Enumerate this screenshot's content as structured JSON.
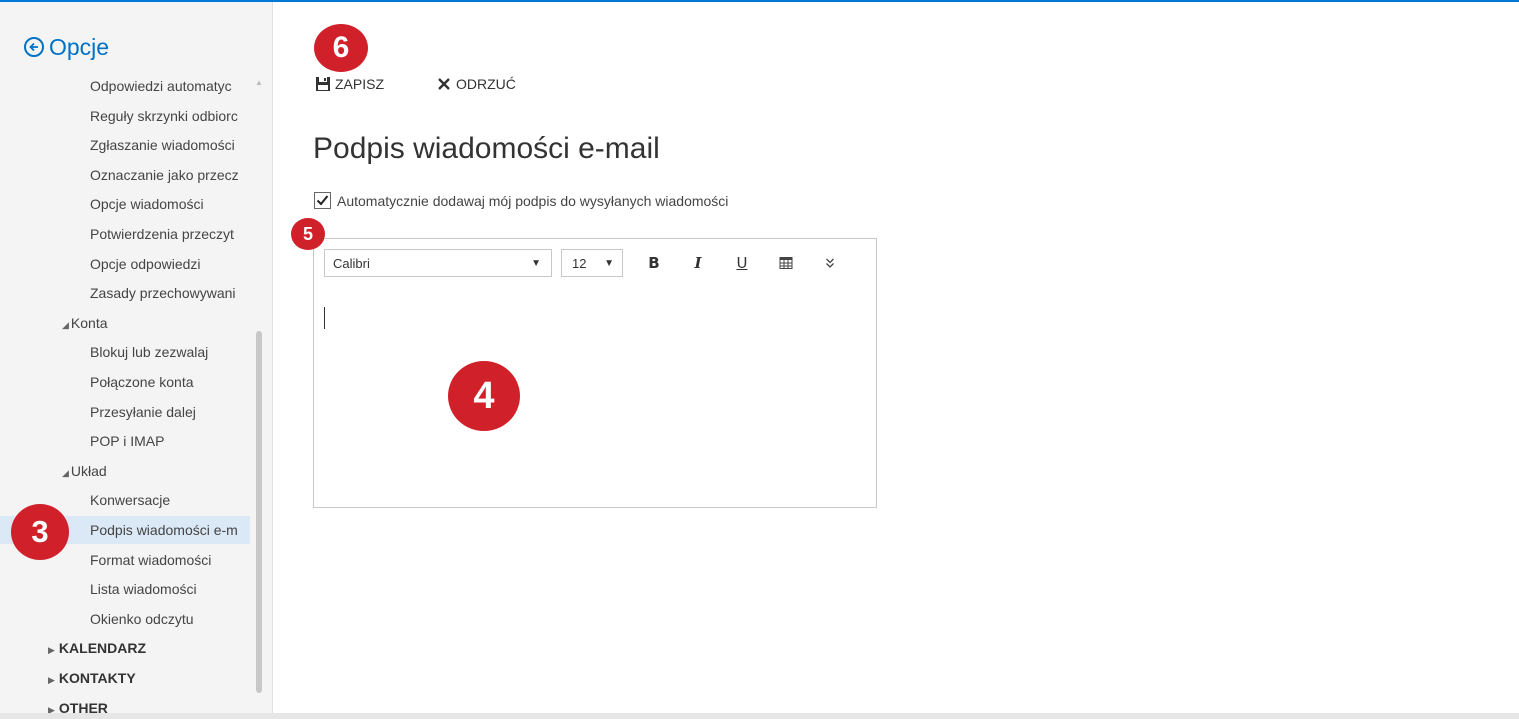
{
  "sidebar": {
    "back_label": "Opcje",
    "items": [
      {
        "label": "Odpowiedzi automatyc",
        "level": "sub"
      },
      {
        "label": "Reguły skrzynki odbiorc",
        "level": "sub"
      },
      {
        "label": "Zgłaszanie wiadomości",
        "level": "sub"
      },
      {
        "label": "Oznaczanie jako przecz",
        "level": "sub"
      },
      {
        "label": "Opcje wiadomości",
        "level": "sub"
      },
      {
        "label": "Potwierdzenia przeczyt",
        "level": "sub"
      },
      {
        "label": "Opcje odpowiedzi",
        "level": "sub"
      },
      {
        "label": "Zasady przechowywani",
        "level": "sub"
      },
      {
        "label": "Konta",
        "level": "sec"
      },
      {
        "label": "Blokuj lub zezwalaj",
        "level": "sub"
      },
      {
        "label": "Połączone konta",
        "level": "sub"
      },
      {
        "label": "Przesyłanie dalej",
        "level": "sub"
      },
      {
        "label": "POP i IMAP",
        "level": "sub"
      },
      {
        "label": "Układ",
        "level": "sec"
      },
      {
        "label": "Konwersacje",
        "level": "sub"
      },
      {
        "label": "Podpis wiadomości e-m",
        "level": "sub",
        "active": true
      },
      {
        "label": "Format wiadomości",
        "level": "sub"
      },
      {
        "label": "Lista wiadomości",
        "level": "sub"
      },
      {
        "label": "Okienko odczytu",
        "level": "sub"
      },
      {
        "label": "KALENDARZ",
        "level": "top"
      },
      {
        "label": "KONTAKTY",
        "level": "top"
      },
      {
        "label": "OTHER",
        "level": "top"
      }
    ]
  },
  "toolbar": {
    "save_label": "ZAPISZ",
    "discard_label": "ODRZUĆ"
  },
  "main": {
    "title": "Podpis wiadomości e-mail",
    "auto_signature_label": "Automatycznie dodawaj mój podpis do wysyłanych wiadomości",
    "auto_signature_checked": true
  },
  "editor": {
    "font": "Calibri",
    "size": "12",
    "bold_label": "B",
    "italic_label": "I",
    "underline_label": "U"
  },
  "badges": [
    "6",
    "5",
    "4",
    "3"
  ],
  "colors": {
    "accent": "#0072c6",
    "badge": "#d0202a",
    "selected_row": "#dbe8f5"
  }
}
